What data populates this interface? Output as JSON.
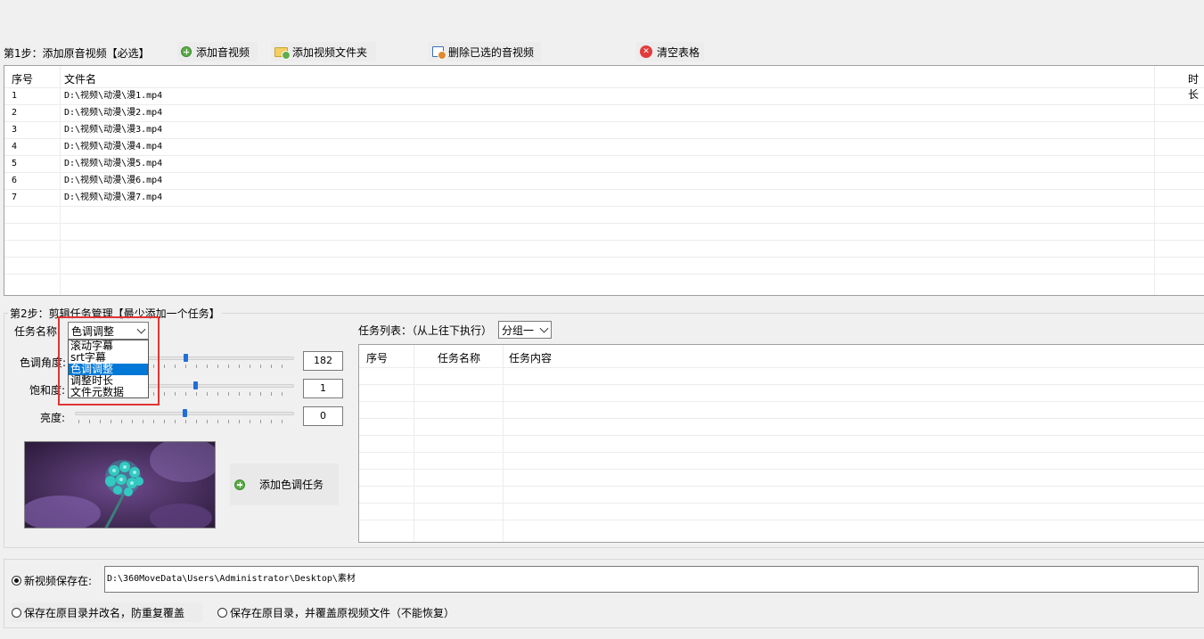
{
  "step1": {
    "label": "第1步：添加原音视频【必选】",
    "buttons": {
      "add_audio_video": "添加音视频",
      "add_video_folder": "添加视频文件夹",
      "delete_selected": "删除已选的音视频",
      "clear_table": "清空表格"
    },
    "table": {
      "columns": [
        "序号",
        "文件名",
        "时长"
      ],
      "rows": [
        {
          "index": "1",
          "file": "D:\\视频\\动漫\\漫1.mp4"
        },
        {
          "index": "2",
          "file": "D:\\视频\\动漫\\漫2.mp4"
        },
        {
          "index": "3",
          "file": "D:\\视频\\动漫\\漫3.mp4"
        },
        {
          "index": "4",
          "file": "D:\\视频\\动漫\\漫4.mp4"
        },
        {
          "index": "5",
          "file": "D:\\视频\\动漫\\漫5.mp4"
        },
        {
          "index": "6",
          "file": "D:\\视频\\动漫\\漫6.mp4"
        },
        {
          "index": "7",
          "file": "D:\\视频\\动漫\\漫7.mp4"
        }
      ]
    }
  },
  "step2": {
    "label": "第2步：剪辑任务管理【最少添加一个任务】",
    "task_name_label": "任务名称:",
    "task_name_value": "色调调整",
    "dropdown_options": [
      "滚动字幕",
      "srt字幕",
      "色调调整",
      "调整时长",
      "文件元数据"
    ],
    "selected_option": "色调调整",
    "hue_label": "色调角度:",
    "hue_value": "182",
    "hue_level": 0.5,
    "saturation_label": "饱和度:",
    "saturation_value": "1",
    "saturation_level": 0.55,
    "brightness_label": "亮度:",
    "brightness_value": "0",
    "brightness_level": 0.5,
    "add_task_button": "添加色调任务",
    "task_list_label": "任务列表：（从上往下执行）",
    "group_value": "分组一",
    "task_table_columns": [
      "序号",
      "任务名称",
      "任务内容"
    ]
  },
  "output": {
    "new_save_label": "新视频保存在:",
    "save_path": "D:\\360MoveData\\Users\\Administrator\\Desktop\\素材",
    "option_rename": "保存在原目录并改名，防重复覆盖",
    "option_overwrite": "保存在原目录，并覆盖原视频文件（不能恢复）"
  },
  "colors": {
    "accent": "#0078d7",
    "highlight_border": "#e13434"
  }
}
